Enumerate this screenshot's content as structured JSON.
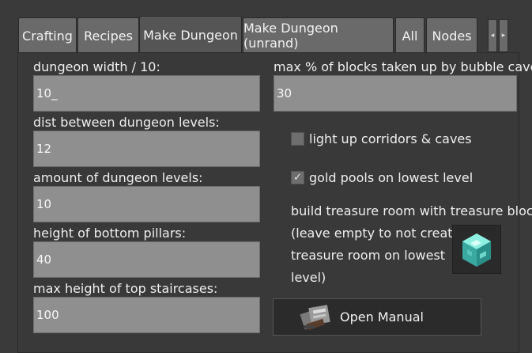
{
  "tabs": [
    {
      "label": "Crafting"
    },
    {
      "label": "Recipes"
    },
    {
      "label": "Make Dungeon",
      "active": true
    },
    {
      "label": "Make Dungeon (unrand)"
    },
    {
      "label": "All"
    },
    {
      "label": "Nodes"
    }
  ],
  "tab_scroll": {
    "left_icon": "◂",
    "right_icon": "▸"
  },
  "fields": [
    {
      "label": "dungeon width / 10:",
      "value": "10_"
    },
    {
      "label": "dist between dungeon levels:",
      "value": "12"
    },
    {
      "label": "amount of dungeon levels:",
      "value": "10"
    },
    {
      "label": "height of bottom pillars:",
      "value": "40"
    },
    {
      "label": "max height of top staircases:",
      "value": "100"
    },
    {
      "label": "max % of blocks taken up by bubble caves:",
      "value": "30"
    }
  ],
  "checkboxes": [
    {
      "label": "light up corridors & caves",
      "checked": false,
      "mark": ""
    },
    {
      "label": "gold pools on lowest level",
      "checked": true,
      "mark": "✓"
    }
  ],
  "treasure": {
    "label": "build treasure room with treasure block:",
    "hint_lines": [
      "(leave empty to not create",
      "treasure room on lowest",
      "level)"
    ],
    "item_icon": "diamond-block-icon"
  },
  "manual_button": {
    "label": "Open Manual",
    "icon": "book-icon"
  },
  "colors": {
    "background": "#3a3a3a",
    "field": "#8f8f8f",
    "tab": "#6a6a6a",
    "text": "#f0f0f0"
  }
}
